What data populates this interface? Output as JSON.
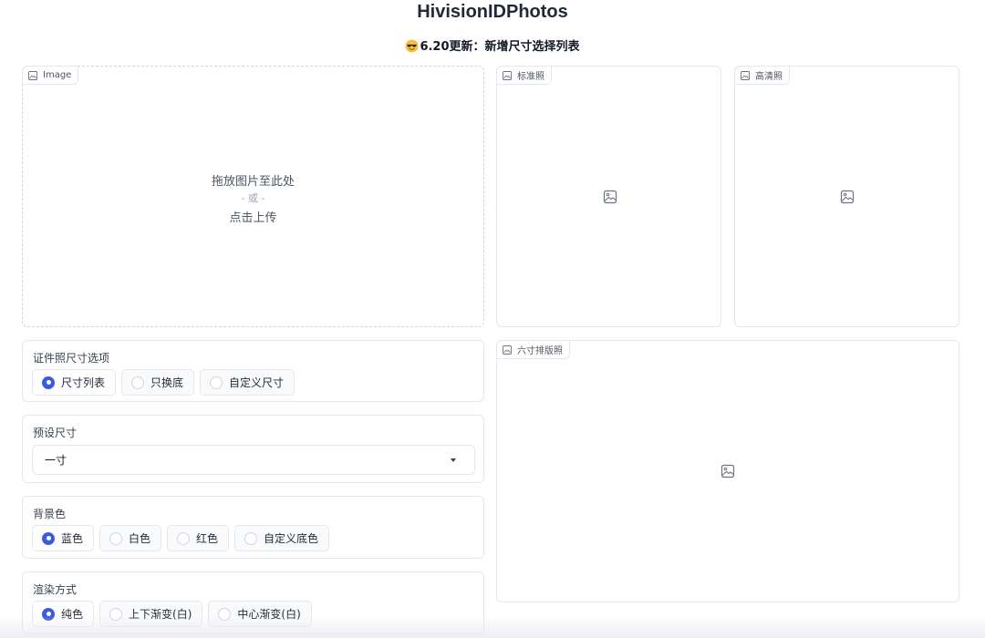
{
  "header": {
    "title": "HivisionIDPhotos",
    "subtitle": "6.20更新：新增尺寸选择列表"
  },
  "upload": {
    "tag_label": "Image",
    "drop_text": "拖放图片至此处",
    "or_text": "- 或 -",
    "click_text": "点击上传"
  },
  "outputs": {
    "standard_label": "标准照",
    "hd_label": "高清照",
    "layout_label": "六寸排版照"
  },
  "size_options": {
    "label": "证件照尺寸选项",
    "options": [
      "尺寸列表",
      "只换底",
      "自定义尺寸"
    ],
    "selected": "尺寸列表"
  },
  "preset_size": {
    "label": "预设尺寸",
    "value": "一寸"
  },
  "background_color": {
    "label": "背景色",
    "options": [
      "蓝色",
      "白色",
      "红色",
      "自定义底色"
    ],
    "selected": "蓝色"
  },
  "render_mode": {
    "label": "渲染方式",
    "options": [
      "纯色",
      "上下渐变(白)",
      "中心渐变(白)"
    ],
    "selected": "纯色"
  },
  "colors": {
    "accent": "#3b5bdb",
    "border": "#e5e7eb"
  },
  "icons": [
    "sunglasses-emoji-icon",
    "image-icon",
    "image-placeholder-icon",
    "dropdown-caret-icon",
    "radio-icon"
  ]
}
